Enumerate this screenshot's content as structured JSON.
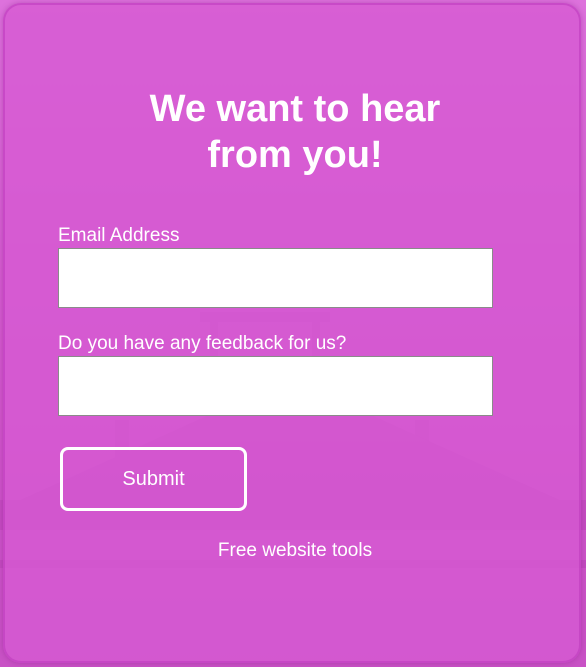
{
  "form": {
    "title_line1": "We want to hear",
    "title_line2": "from you!",
    "email_label": "Email Address",
    "email_value": "",
    "feedback_label": "Do you have any feedback for us?",
    "feedback_value": "",
    "submit_label": "Submit"
  },
  "footer": {
    "link_text": "Free website tools"
  },
  "colors": {
    "background": "#d45ccf",
    "text": "#ffffff",
    "input_bg": "#ffffff"
  }
}
